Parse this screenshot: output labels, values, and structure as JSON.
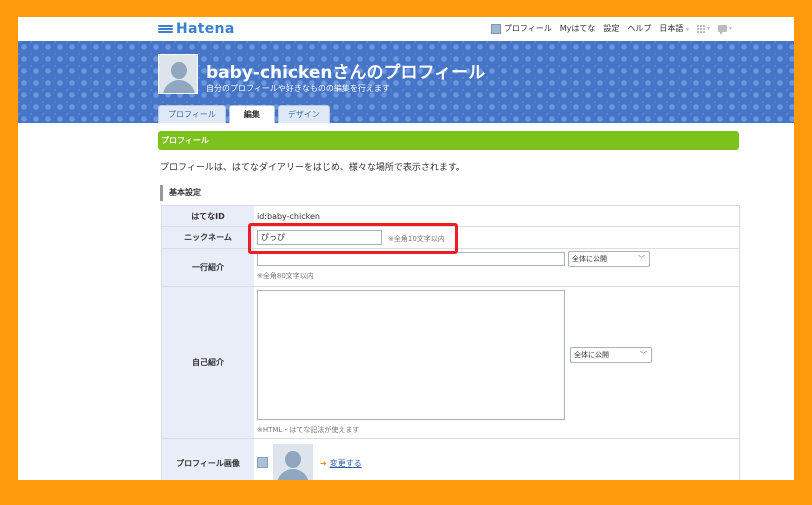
{
  "brand": {
    "logo_text": "Hatena"
  },
  "topnav": {
    "profile": "プロフィール",
    "my_hatena": "Myはてな",
    "settings": "設定",
    "help": "ヘルプ",
    "language": "日本語",
    "language_chevron": "▾",
    "apps_chevron": "▾",
    "notify_chevron": "▾"
  },
  "header": {
    "title": "baby-chickenさんのプロフィール",
    "subtitle": "自分のプロフィールや好きなものの編集を行えます",
    "tabs": [
      {
        "label": "プロフィール"
      },
      {
        "label": "編集"
      },
      {
        "label": "デザイン"
      }
    ]
  },
  "main": {
    "section_title": "プロフィール",
    "section_desc": "プロフィールは、はてなダイアリーをはじめ、様々な場所で表示されます。",
    "basic_heading": "基本設定",
    "form": {
      "hatena_id": {
        "label": "はてなID",
        "value": "id:baby-chicken"
      },
      "nickname": {
        "label": "ニックネーム",
        "value": "ぴっぴ",
        "note": "※全角10文字以内"
      },
      "one_line": {
        "label": "一行紹介",
        "value": "",
        "note": "※全角80文字以内",
        "visibility": "全体に公開"
      },
      "bio": {
        "label": "自己紹介",
        "value": "",
        "note": "※HTML・はてな記法が使えます",
        "visibility": "全体に公開"
      },
      "profile_image": {
        "label": "プロフィール画像",
        "change_link": "変更する"
      }
    }
  },
  "colors": {
    "background_frame": "#ff9a0a",
    "header_blue": "#4675c8",
    "section_green": "#7dc11c",
    "highlight_red": "#ee1c24",
    "label_bg": "#e8edf7"
  }
}
